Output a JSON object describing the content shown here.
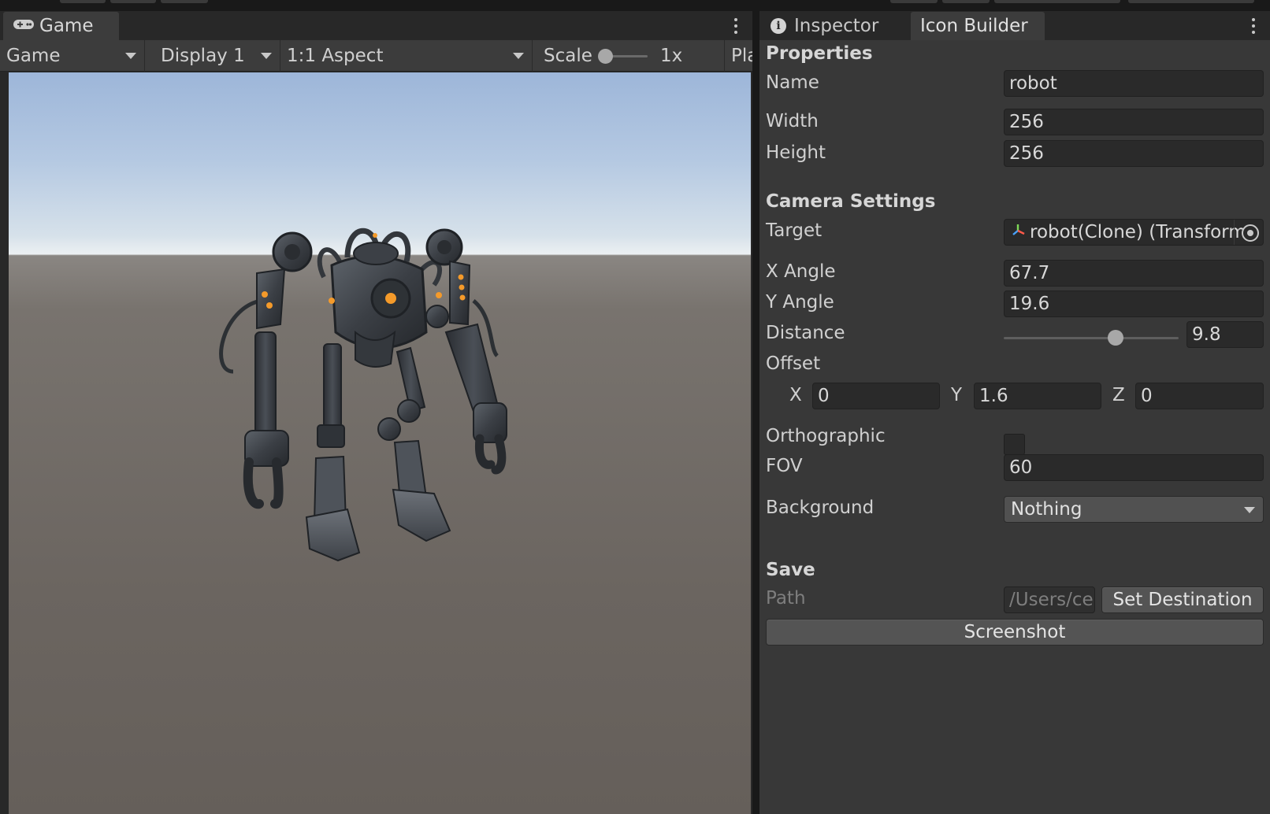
{
  "game": {
    "tab_label": "Game",
    "toolbar": {
      "mode": "Game",
      "display": "Display 1",
      "aspect": "1:1 Aspect",
      "scale_label": "Scale",
      "scale_value": "1x",
      "play_truncated": "Pla"
    }
  },
  "inspector": {
    "tabs": [
      {
        "label": "Inspector"
      },
      {
        "label": "Icon Builder"
      }
    ],
    "properties": {
      "heading": "Properties",
      "name_label": "Name",
      "name_value": "robot",
      "width_label": "Width",
      "width_value": "256",
      "height_label": "Height",
      "height_value": "256"
    },
    "camera": {
      "heading": "Camera Settings",
      "target_label": "Target",
      "target_value": "robot(Clone) (Transform",
      "x_angle_label": "X Angle",
      "x_angle_value": "67.7",
      "y_angle_label": "Y Angle",
      "y_angle_value": "19.6",
      "distance_label": "Distance",
      "distance_value": "9.8",
      "distance_slider_fraction": 0.64,
      "offset_label": "Offset",
      "offset_x_label": "X",
      "offset_x_value": "0",
      "offset_y_label": "Y",
      "offset_y_value": "1.6",
      "offset_z_label": "Z",
      "offset_z_value": "0",
      "orthographic_label": "Orthographic",
      "orthographic_checked": false,
      "fov_label": "FOV",
      "fov_value": "60",
      "background_label": "Background",
      "background_value": "Nothing"
    },
    "save": {
      "heading": "Save",
      "path_label": "Path",
      "path_value": "/Users/ce",
      "set_destination_label": "Set Destination",
      "screenshot_label": "Screenshot"
    }
  },
  "colors": {
    "accent_orange": "#f49a2a",
    "panel_bg": "#383838",
    "field_bg": "#2a2a2a"
  }
}
